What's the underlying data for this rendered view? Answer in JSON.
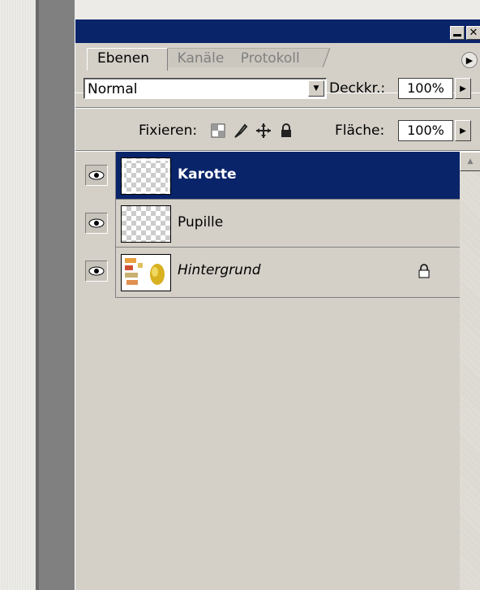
{
  "tabs": [
    "Ebenen",
    "Kanäle",
    "Protokoll"
  ],
  "blend_mode": "Normal",
  "opacity_label": "Deckkr.:",
  "opacity_value": "100%",
  "lock_label": "Fixieren:",
  "fill_label": "Fläche:",
  "fill_value": "100%",
  "layers": [
    {
      "name": "Karotte",
      "selected": true,
      "visible": true
    },
    {
      "name": "Pupille",
      "selected": false,
      "visible": true
    },
    {
      "name": "Hintergrund",
      "selected": false,
      "visible": true,
      "locked": true,
      "italic": true
    }
  ],
  "colors": {
    "titlebar": "#0a246a",
    "selection": "#0a246a",
    "panel": "#d4d0c8"
  }
}
